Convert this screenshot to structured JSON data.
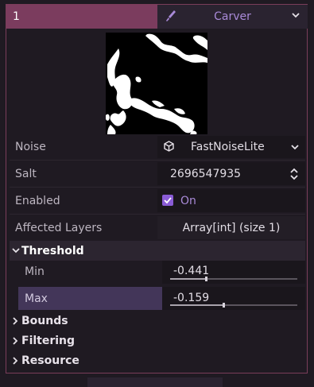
{
  "header": {
    "index": "1",
    "resource_name": "Carver",
    "resource_icon": "brush-icon"
  },
  "properties": {
    "noise": {
      "label": "Noise",
      "value": "FastNoiseLite",
      "icon": "cube-icon"
    },
    "salt": {
      "label": "Salt",
      "value": "2696547935"
    },
    "enabled": {
      "label": "Enabled",
      "value": "On",
      "checked": true
    },
    "affected_layers": {
      "label": "Affected Layers",
      "value": "Array[int] (size 1)"
    }
  },
  "threshold": {
    "label": "Threshold",
    "min": {
      "label": "Min",
      "value": "-0.441",
      "level": 0.28
    },
    "max": {
      "label": "Max",
      "value": "-0.159",
      "level": 0.42
    }
  },
  "sections": {
    "bounds": "Bounds",
    "filtering": "Filtering",
    "resource": "Resource"
  },
  "colors": {
    "accent": "#7b3c5e",
    "highlight": "#433659",
    "checkbox": "#8a5cd6",
    "resource_text": "#a98ad8"
  }
}
